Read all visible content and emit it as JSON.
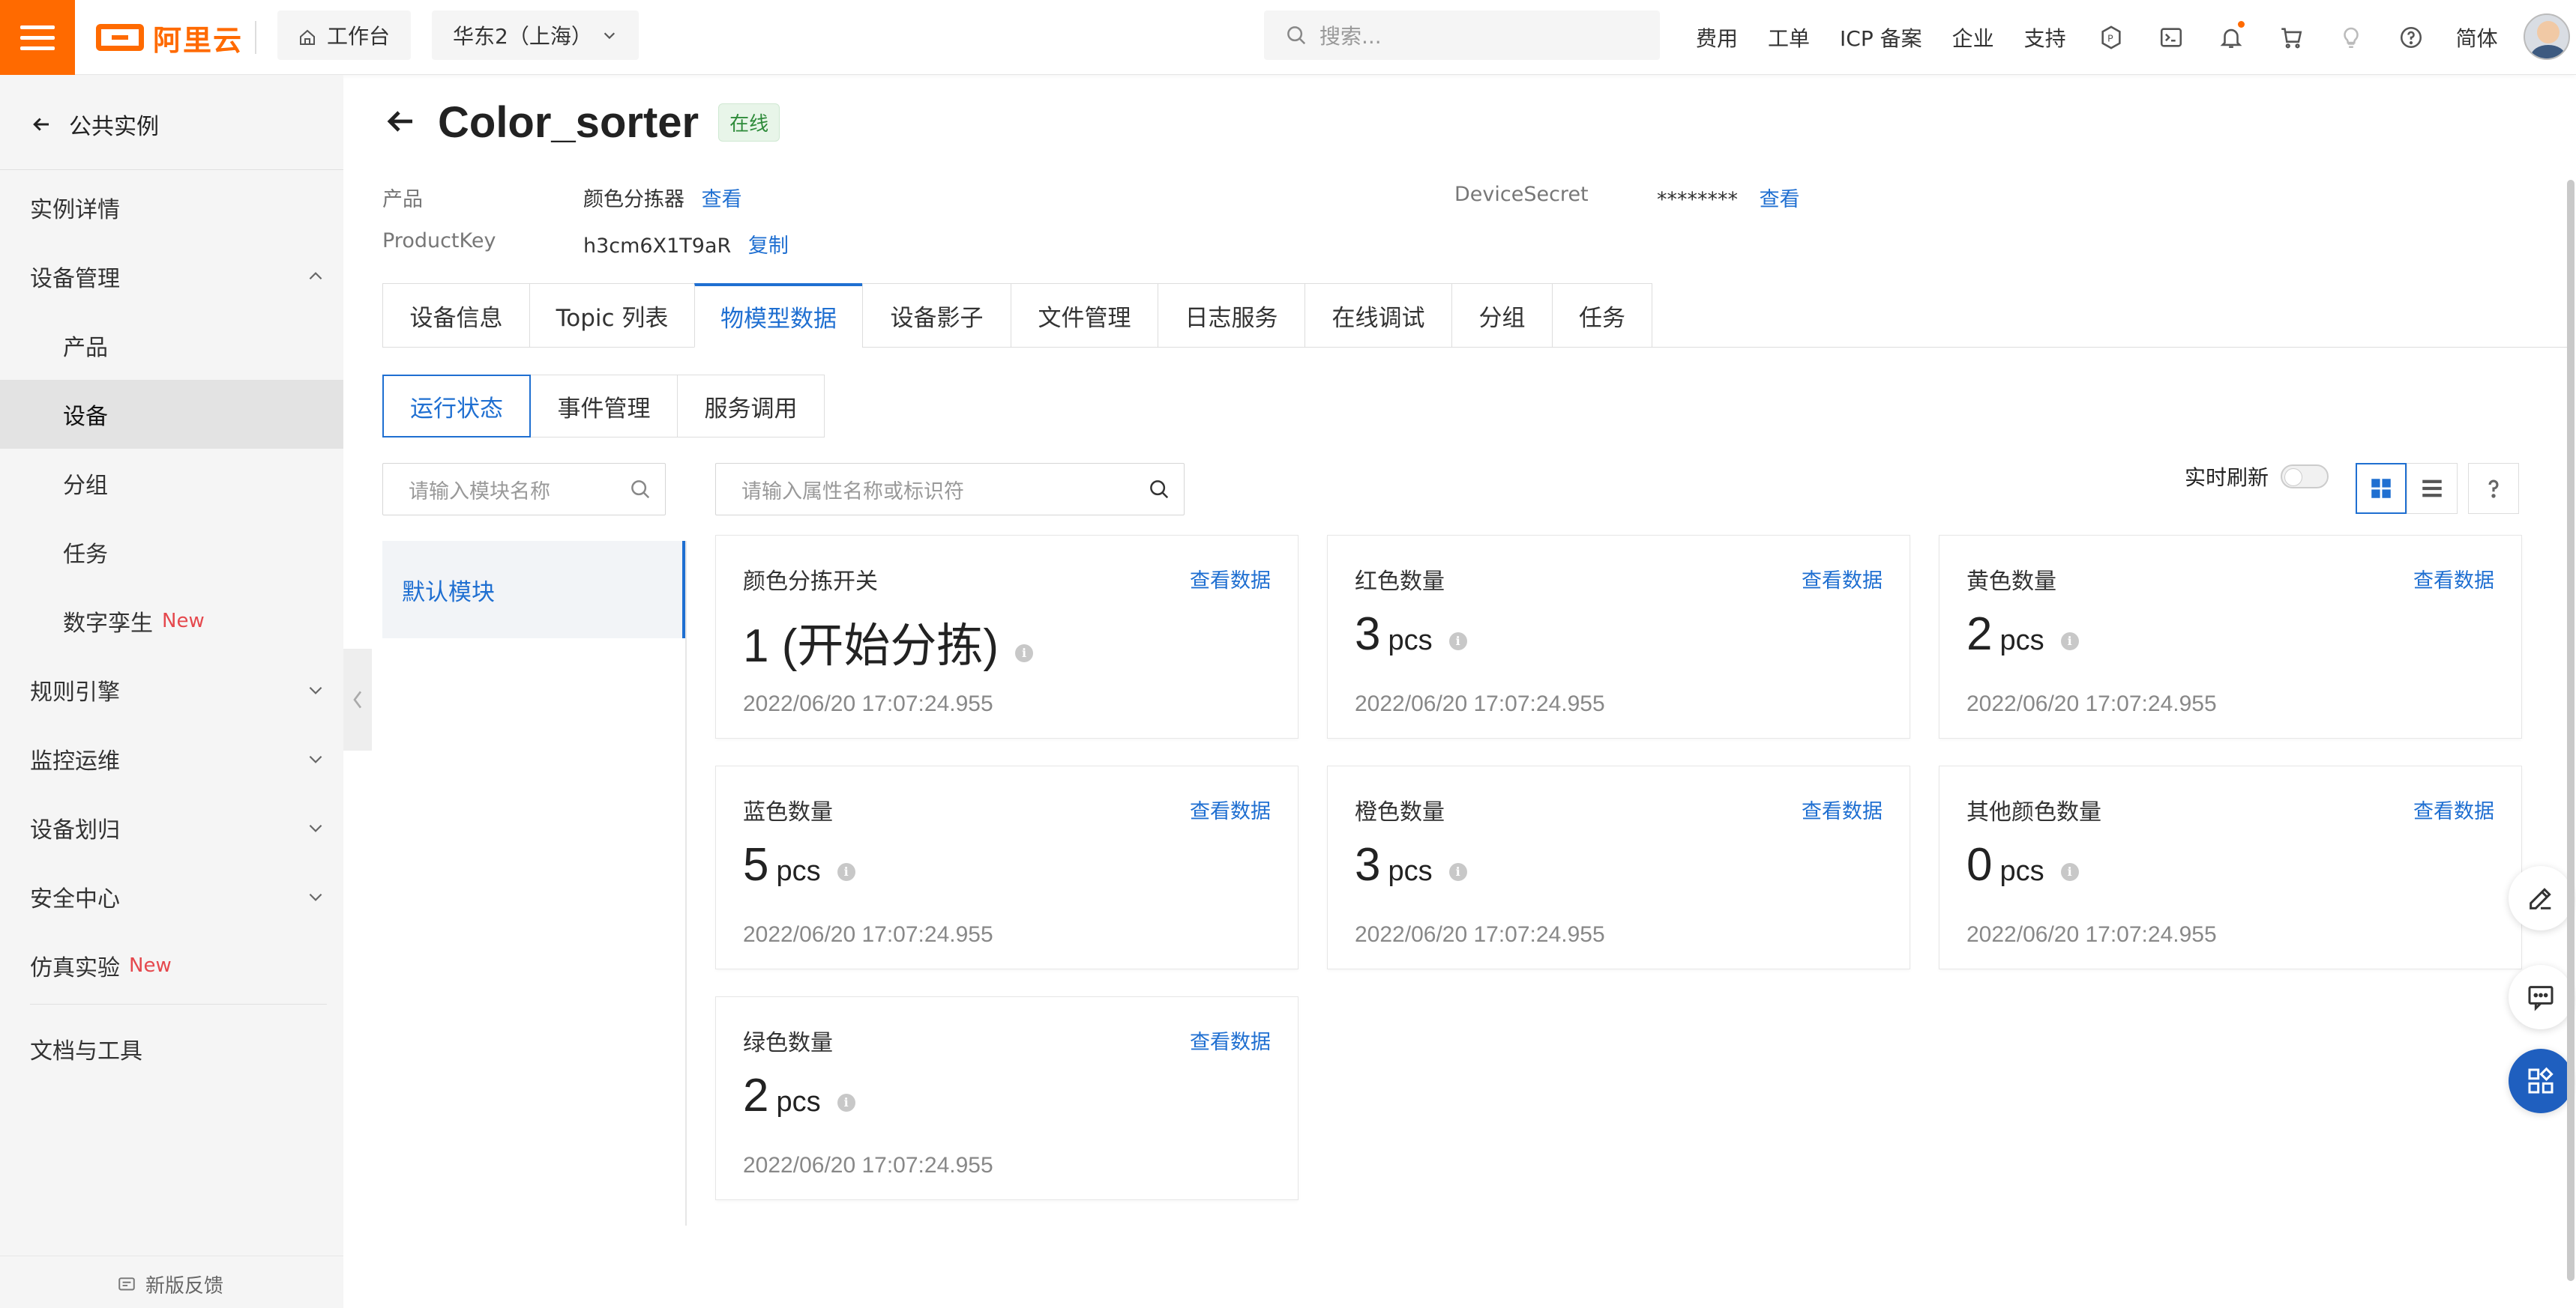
{
  "topbar": {
    "brand": "阿里云",
    "workbench": "工作台",
    "region": "华东2（上海）",
    "search_placeholder": "搜索...",
    "nav": [
      "费用",
      "工单",
      "ICP 备案",
      "企业",
      "支持"
    ],
    "lang": "简体",
    "accent_color": "#ff6a00"
  },
  "sidebar": {
    "back_label": "公共实例",
    "items": [
      {
        "label": "实例详情"
      },
      {
        "label": "设备管理"
      },
      {
        "label": "产品"
      },
      {
        "label": "设备"
      },
      {
        "label": "分组"
      },
      {
        "label": "任务"
      },
      {
        "label": "数字孪生",
        "tag": "New"
      },
      {
        "label": "规则引擎"
      },
      {
        "label": "监控运维"
      },
      {
        "label": "设备划归"
      },
      {
        "label": "安全中心"
      },
      {
        "label": "仿真实验",
        "tag": "New"
      },
      {
        "label": "文档与工具"
      }
    ],
    "feedback": "新版反馈"
  },
  "device": {
    "name": "Color_sorter",
    "status": "在线",
    "product_key_label": "产品",
    "product_value": "颜色分拣器",
    "view_link": "查看",
    "productkey_label": "ProductKey",
    "productkey_value": "h3cm6X1T9aR",
    "copy_link": "复制",
    "secret_label": "DeviceSecret",
    "secret_value": "********",
    "secret_view": "查看"
  },
  "tabs": [
    "设备信息",
    "Topic 列表",
    "物模型数据",
    "设备影子",
    "文件管理",
    "日志服务",
    "在线调试",
    "分组",
    "任务"
  ],
  "subtabs": [
    "运行状态",
    "事件管理",
    "服务调用"
  ],
  "filters": {
    "module_placeholder": "请输入模块名称",
    "property_placeholder": "请输入属性名称或标识符",
    "realtime_label": "实时刷新"
  },
  "module": {
    "default": "默认模块"
  },
  "cards": [
    {
      "name": "颜色分拣开关",
      "link": "查看数据",
      "value": "1 (开始分拣)",
      "unit": "",
      "time": "2022/06/20 17:07:24.955"
    },
    {
      "name": "红色数量",
      "link": "查看数据",
      "value": "3",
      "unit": "pcs",
      "time": "2022/06/20 17:07:24.955"
    },
    {
      "name": "黄色数量",
      "link": "查看数据",
      "value": "2",
      "unit": "pcs",
      "time": "2022/06/20 17:07:24.955"
    },
    {
      "name": "蓝色数量",
      "link": "查看数据",
      "value": "5",
      "unit": "pcs",
      "time": "2022/06/20 17:07:24.955"
    },
    {
      "name": "橙色数量",
      "link": "查看数据",
      "value": "3",
      "unit": "pcs",
      "time": "2022/06/20 17:07:24.955"
    },
    {
      "name": "其他颜色数量",
      "link": "查看数据",
      "value": "0",
      "unit": "pcs",
      "time": "2022/06/20 17:07:24.955"
    },
    {
      "name": "绿色数量",
      "link": "查看数据",
      "value": "2",
      "unit": "pcs",
      "time": "2022/06/20 17:07:24.955"
    }
  ]
}
